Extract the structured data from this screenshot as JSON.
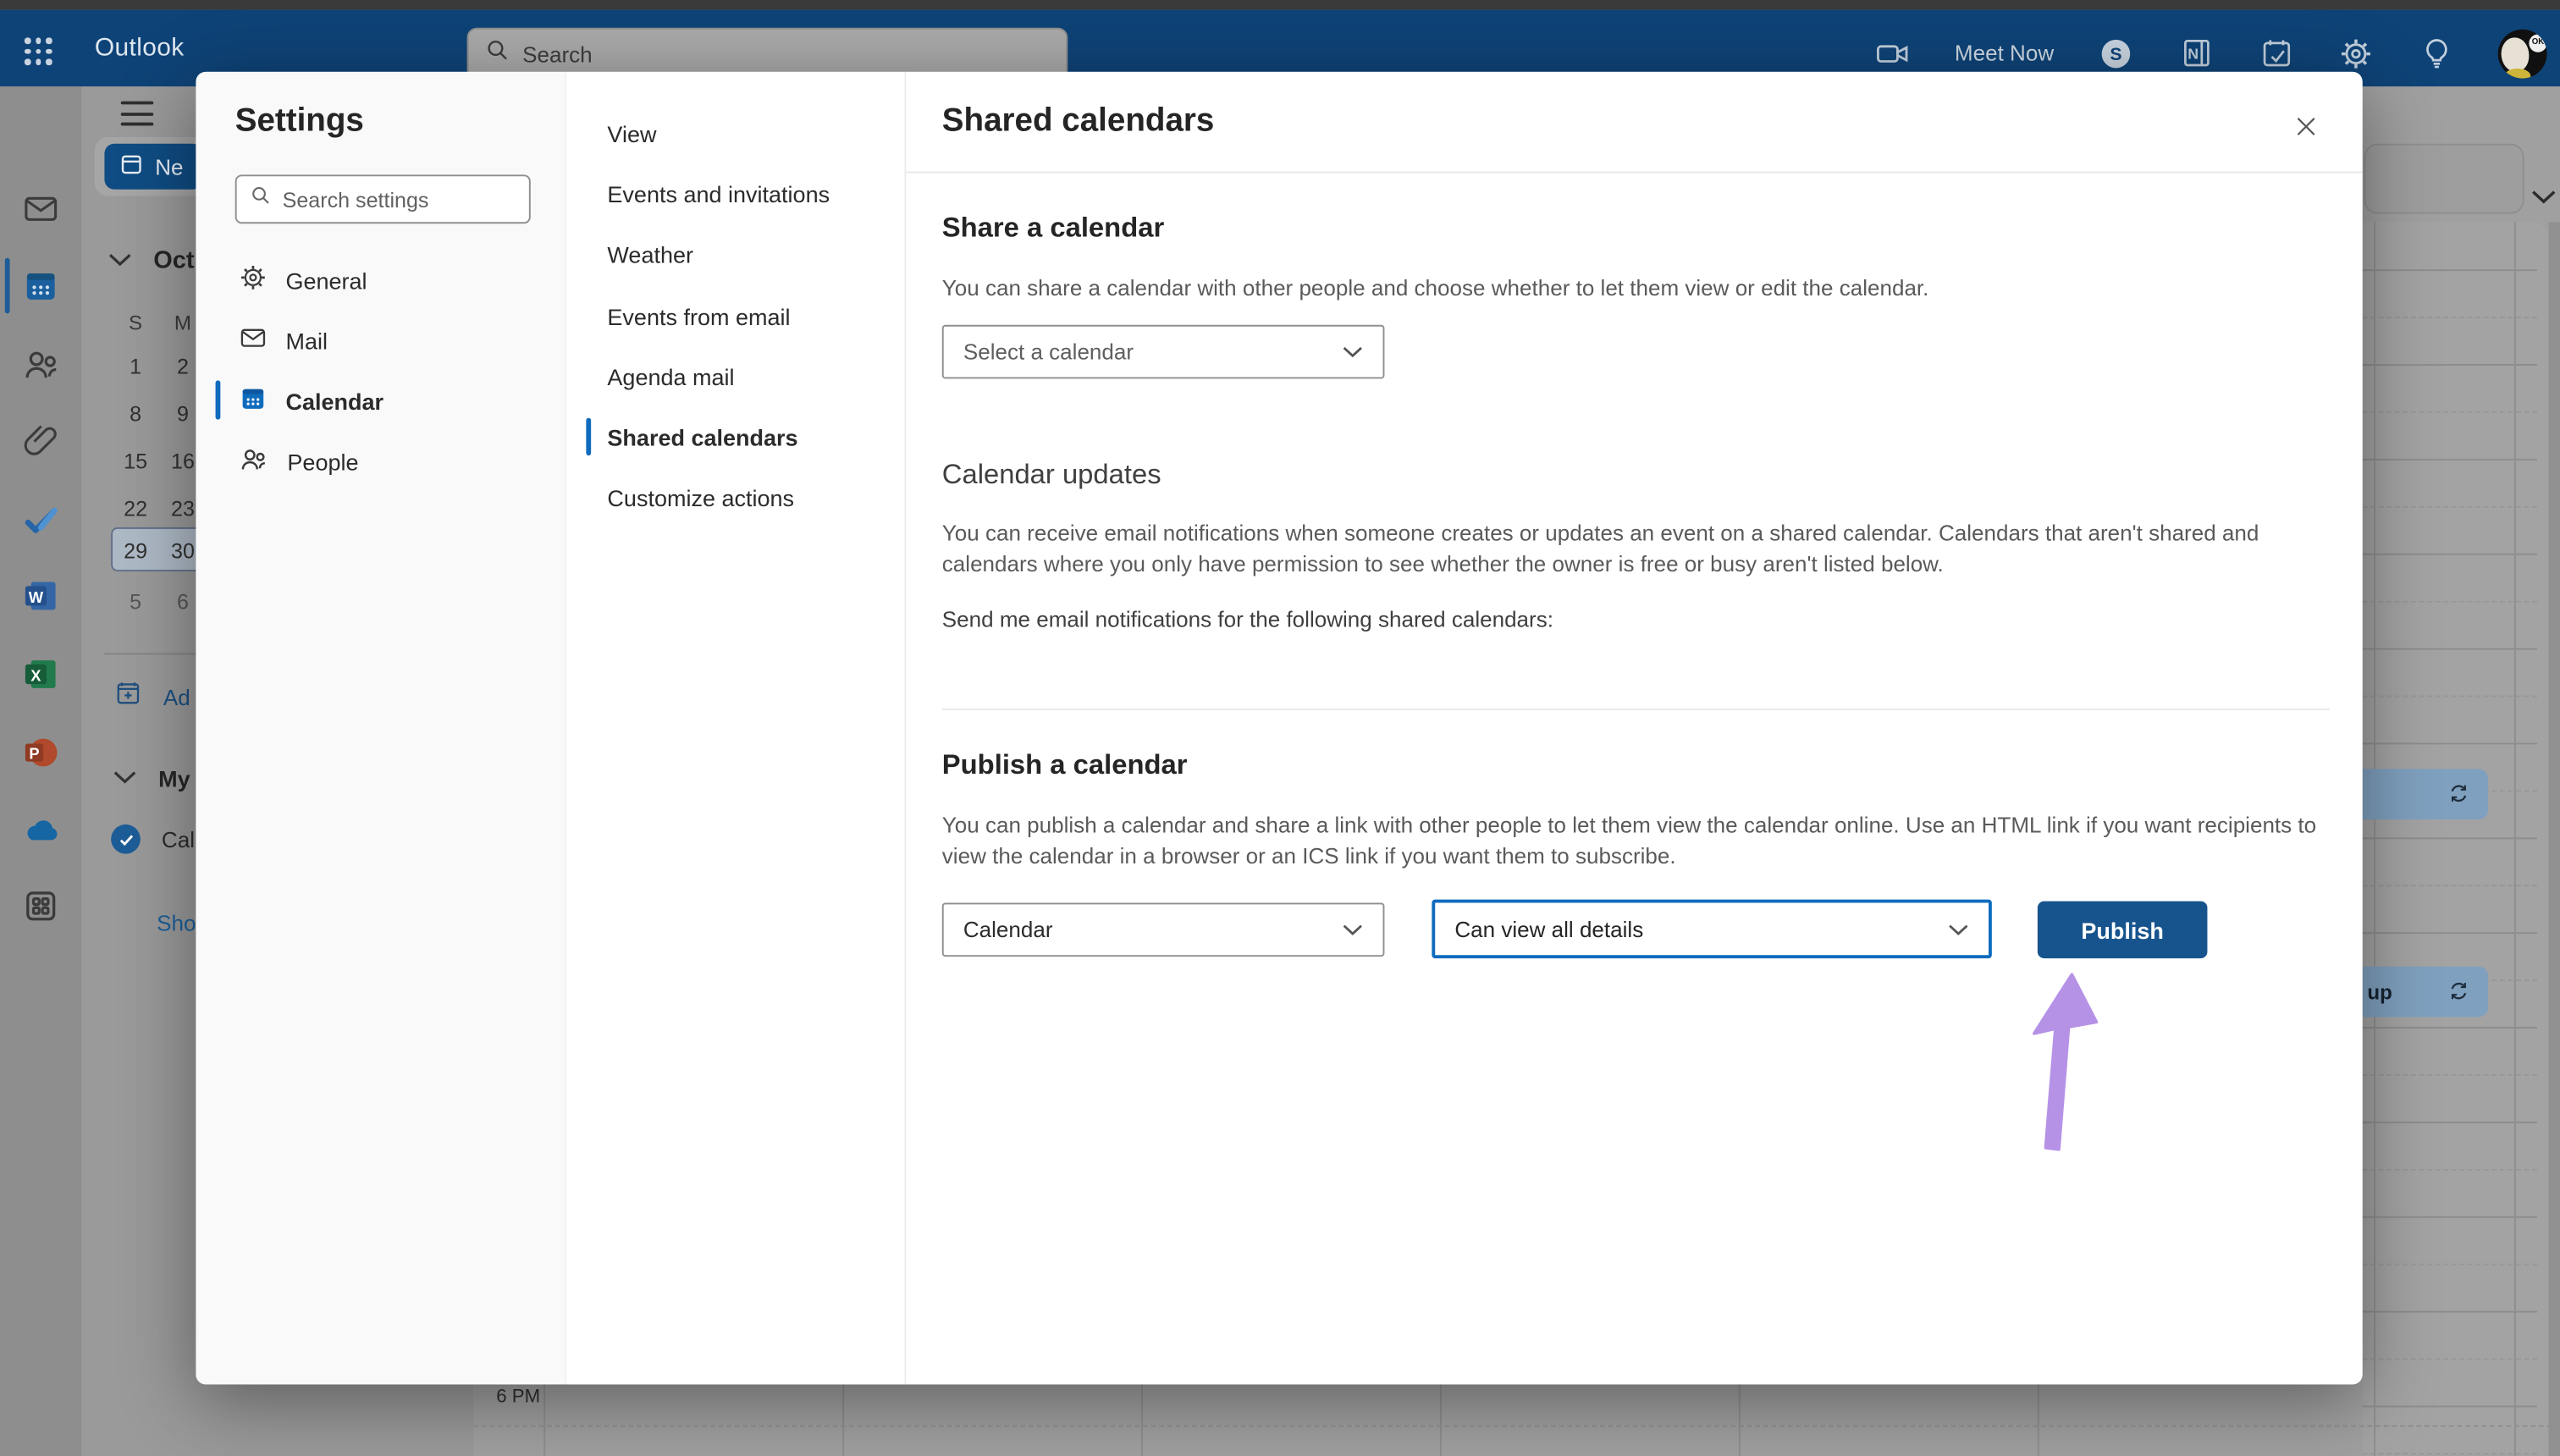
{
  "topbar": {
    "brand": "Outlook",
    "search_placeholder": "Search",
    "meet_now_label": "Meet Now",
    "icons": [
      "meet-now-camera-icon",
      "skype-icon",
      "onenote-icon",
      "tasks-icon",
      "settings-gear-icon",
      "tips-lightbulb-icon",
      "account-avatar"
    ]
  },
  "rail": {
    "items": [
      "mail-icon",
      "calendar-icon",
      "people-icon",
      "attachments-icon",
      "todo-icon",
      "word-icon",
      "excel-icon",
      "powerpoint-icon",
      "onedrive-icon",
      "more-apps-icon"
    ],
    "selected": "calendar-icon"
  },
  "sidebar": {
    "new_event_label": "Ne",
    "month_label": "Oct",
    "day_headers": [
      "S",
      "M"
    ],
    "weeks": [
      [
        "1",
        "2"
      ],
      [
        "8",
        "9"
      ],
      [
        "15",
        "16"
      ],
      [
        "22",
        "23"
      ],
      [
        "29",
        "30"
      ],
      [
        "5",
        "6"
      ]
    ],
    "selected_week_index": 4,
    "add_calendar_label": "Ad",
    "my_calendars_label": "My",
    "calendar_item_label": "Cal",
    "show_link_label": "Sho"
  },
  "grid": {
    "time_label": "6 PM",
    "events": [
      {
        "label": "",
        "recurring": true
      },
      {
        "label": "up",
        "recurring": true
      }
    ]
  },
  "settings": {
    "title": "Settings",
    "search_placeholder": "Search settings",
    "nav": [
      {
        "label": "General"
      },
      {
        "label": "Mail"
      },
      {
        "label": "Calendar"
      },
      {
        "label": "People"
      }
    ],
    "selected_nav": "Calendar",
    "subnav": [
      {
        "label": "View"
      },
      {
        "label": "Events and invitations"
      },
      {
        "label": "Weather"
      },
      {
        "label": "Events from email"
      },
      {
        "label": "Agenda mail"
      },
      {
        "label": "Shared calendars"
      },
      {
        "label": "Customize actions"
      }
    ],
    "selected_subnav": "Shared calendars"
  },
  "panel": {
    "title": "Shared calendars",
    "share": {
      "heading": "Share a calendar",
      "body": "You can share a calendar with other people and choose whether to let them view or edit the calendar.",
      "select_placeholder": "Select a calendar"
    },
    "updates": {
      "heading": "Calendar updates",
      "body": "You can receive email notifications when someone creates or updates an event on a shared calendar. Calendars that aren't shared and calendars where you only have permission to see whether the owner is free or busy aren't listed below.",
      "notifications_label": "Send me email notifications for the following shared calendars:"
    },
    "publish": {
      "heading": "Publish a calendar",
      "body": "You can publish a calendar and share a link with other people to let them view the calendar online. Use an HTML link if you want recipients to view the calendar in a browser or an ICS link if you want them to subscribe.",
      "calendar_value": "Calendar",
      "permission_value": "Can view all details",
      "button_label": "Publish"
    }
  },
  "colors": {
    "accent": "#0f6cbd",
    "topbar": "#0e4377",
    "publish_button": "#17548e",
    "arrow": "#b18ae6",
    "event": "#7fa0bf"
  }
}
